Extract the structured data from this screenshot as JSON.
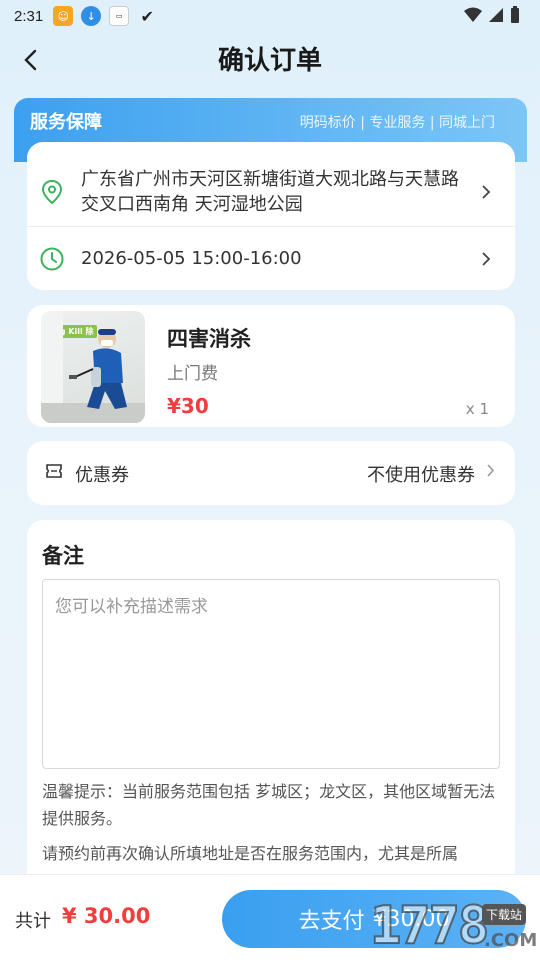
{
  "status_bar": {
    "time": "2:31"
  },
  "header": {
    "title": "确认订单"
  },
  "service_banner": {
    "title": "服务保障",
    "tags": "明码标价 | 专业服务 | 同城上门"
  },
  "address": {
    "text": "广东省广州市天河区新塘街道大观北路与天慧路交叉口西南角 天河湿地公园",
    "time": "2026-05-05 15:00-16:00"
  },
  "product": {
    "name": "四害消杀",
    "subtitle": "上门费",
    "price": "¥30",
    "qty": "x 1",
    "thumb_banner": "Bug Kill 除"
  },
  "coupon": {
    "label": "优惠券",
    "value": "不使用优惠券"
  },
  "remark": {
    "title": "备注",
    "placeholder": "您可以补充描述需求",
    "tip1": "温馨提示：当前服务范围包括 芗城区；龙文区，其他区域暂无法提供服务。",
    "tip2": "请预约前再次确认所填地址是否在服务范围内，尤其是所属"
  },
  "footer": {
    "total_label": "共计",
    "total_value": "¥ 30.00",
    "pay_label": "去支付",
    "pay_amount": "¥30.00"
  },
  "watermark": {
    "text": "1778",
    "tag": "下载站",
    "domain": ".COM"
  },
  "colors": {
    "accent": "#3a9ff0",
    "price": "#f23d3d",
    "icon_green": "#3cb35a"
  }
}
